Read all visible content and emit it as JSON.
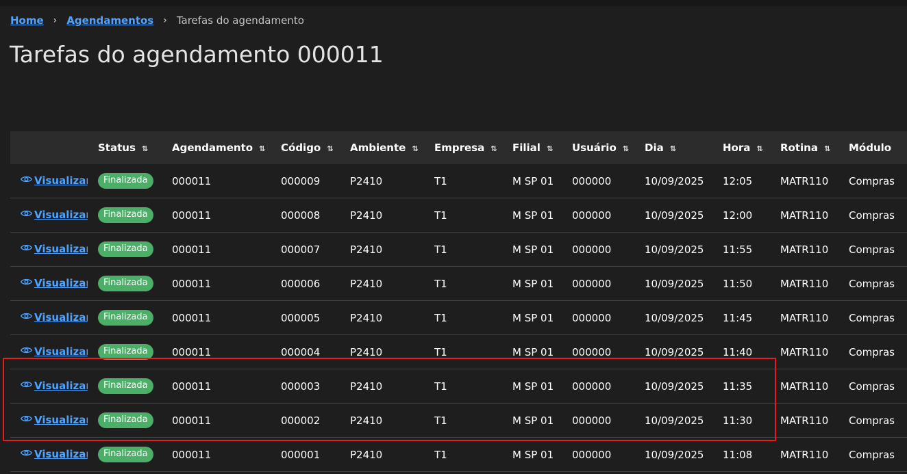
{
  "breadcrumb": {
    "home": "Home",
    "separator": "›",
    "agendamentos": "Agendamentos",
    "current": "Tarefas do agendamento"
  },
  "page_title": "Tarefas do agendamento 000011",
  "colors": {
    "background": "#1e1e1e",
    "header_bg": "#2c2c2c",
    "link": "#4fa3ff",
    "badge_green": "#4caf68",
    "highlight_red": "#e02020"
  },
  "table": {
    "sort_icon": "⇅",
    "columns": [
      "",
      "Status",
      "Agendamento",
      "Código",
      "Ambiente",
      "Empresa",
      "Filial",
      "Usuário",
      "Dia",
      "Hora",
      "Rotina",
      "Módulo"
    ],
    "view_label": "Visualizar",
    "rows": [
      {
        "status": "Finalizada",
        "agendamento": "000011",
        "codigo": "000009",
        "ambiente": "P2410",
        "empresa": "T1",
        "filial": "M SP 01",
        "usuario": "000000",
        "dia": "10/09/2025",
        "hora": "12:05",
        "rotina": "MATR110",
        "modulo": "Compras"
      },
      {
        "status": "Finalizada",
        "agendamento": "000011",
        "codigo": "000008",
        "ambiente": "P2410",
        "empresa": "T1",
        "filial": "M SP 01",
        "usuario": "000000",
        "dia": "10/09/2025",
        "hora": "12:00",
        "rotina": "MATR110",
        "modulo": "Compras"
      },
      {
        "status": "Finalizada",
        "agendamento": "000011",
        "codigo": "000007",
        "ambiente": "P2410",
        "empresa": "T1",
        "filial": "M SP 01",
        "usuario": "000000",
        "dia": "10/09/2025",
        "hora": "11:55",
        "rotina": "MATR110",
        "modulo": "Compras"
      },
      {
        "status": "Finalizada",
        "agendamento": "000011",
        "codigo": "000006",
        "ambiente": "P2410",
        "empresa": "T1",
        "filial": "M SP 01",
        "usuario": "000000",
        "dia": "10/09/2025",
        "hora": "11:50",
        "rotina": "MATR110",
        "modulo": "Compras"
      },
      {
        "status": "Finalizada",
        "agendamento": "000011",
        "codigo": "000005",
        "ambiente": "P2410",
        "empresa": "T1",
        "filial": "M SP 01",
        "usuario": "000000",
        "dia": "10/09/2025",
        "hora": "11:45",
        "rotina": "MATR110",
        "modulo": "Compras"
      },
      {
        "status": "Finalizada",
        "agendamento": "000011",
        "codigo": "000004",
        "ambiente": "P2410",
        "empresa": "T1",
        "filial": "M SP 01",
        "usuario": "000000",
        "dia": "10/09/2025",
        "hora": "11:40",
        "rotina": "MATR110",
        "modulo": "Compras"
      },
      {
        "status": "Finalizada",
        "agendamento": "000011",
        "codigo": "000003",
        "ambiente": "P2410",
        "empresa": "T1",
        "filial": "M SP 01",
        "usuario": "000000",
        "dia": "10/09/2025",
        "hora": "11:35",
        "rotina": "MATR110",
        "modulo": "Compras"
      },
      {
        "status": "Finalizada",
        "agendamento": "000011",
        "codigo": "000002",
        "ambiente": "P2410",
        "empresa": "T1",
        "filial": "M SP 01",
        "usuario": "000000",
        "dia": "10/09/2025",
        "hora": "11:30",
        "rotina": "MATR110",
        "modulo": "Compras"
      },
      {
        "status": "Finalizada",
        "agendamento": "000011",
        "codigo": "000001",
        "ambiente": "P2410",
        "empresa": "T1",
        "filial": "M SP 01",
        "usuario": "000000",
        "dia": "10/09/2025",
        "hora": "11:08",
        "rotina": "MATR110",
        "modulo": "Compras"
      }
    ]
  }
}
